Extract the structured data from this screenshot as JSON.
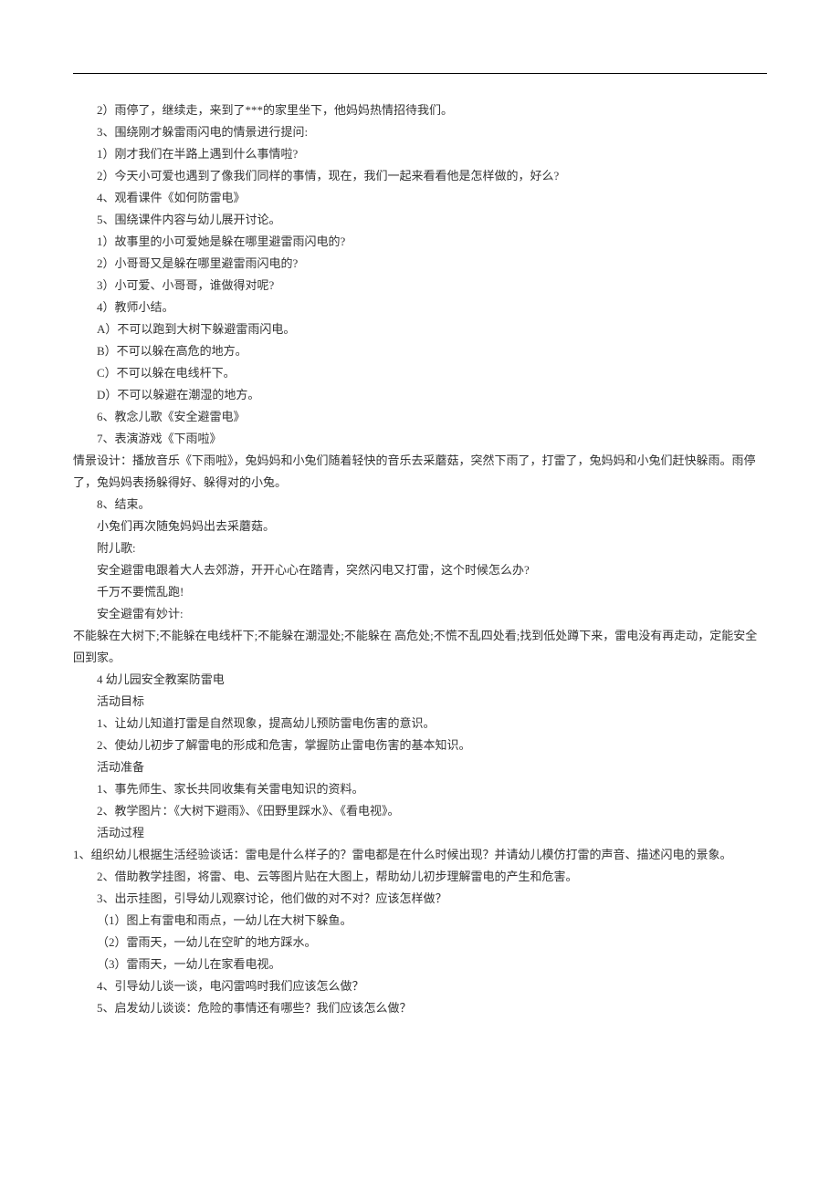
{
  "lines": [
    "2）雨停了，继续走，来到了***的家里坐下，他妈妈热情招待我们。",
    "3、围绕刚才躲雷雨闪电的情景进行提问:",
    "1）刚才我们在半路上遇到什么事情啦?",
    "2）今天小可爱也遇到了像我们同样的事情，现在，我们一起来看看他是怎样做的，好么?",
    "4、观看课件《如何防雷电》",
    "5、围绕课件内容与幼儿展开讨论。",
    "1）故事里的小可爱她是躲在哪里避雷雨闪电的?",
    "2）小哥哥又是躲在哪里避雷雨闪电的?",
    "3）小可爱、小哥哥，谁做得对呢?",
    "4）教师小结。",
    "A）不可以跑到大树下躲避雷雨闪电。",
    "B）不可以躲在高危的地方。",
    "C）不可以躲在电线杆下。",
    "D）不可以躲避在潮湿的地方。",
    "6、教念儿歌《安全避雷电》",
    "7、表演游戏《下雨啦》",
    "情景设计：播放音乐《下雨啦》，兔妈妈和小兔们随着轻快的音乐去采蘑菇，突然下雨了，打雷了，兔妈妈和小兔们赶快躲雨。雨停了，兔妈妈表扬躲得好、躲得对的小兔。",
    "8、结束。",
    "小兔们再次随兔妈妈出去采蘑菇。",
    "附儿歌:",
    "安全避雷电跟着大人去郊游，开开心心在踏青，突然闪电又打雷，这个时候怎么办?",
    "千万不要慌乱跑!",
    "安全避雷有妙计:",
    "不能躲在大树下;不能躲在电线杆下;不能躲在潮湿处;不能躲在 高危处;不慌不乱四处看;找到低处蹲下来，雷电没有再走动，定能安全回到家。",
    "4 幼儿园安全教案防雷电",
    "活动目标",
    "1、让幼儿知道打雷是自然现象，提高幼儿预防雷电伤害的意识。",
    "2、使幼儿初步了解雷电的形成和危害，掌握防止雷电伤害的基本知识。",
    "活动准备",
    "1、事先师生、家长共同收集有关雷电知识的资料。",
    "2、教学图片：《大树下避雨》、《田野里踩水》、《看电视》。",
    "活动过程",
    "1、组织幼儿根据生活经验谈话：雷电是什么样子的？雷电都是在什么时候出现？并请幼儿模仿打雷的声音、描述闪电的景象。",
    "2、借助教学挂图，将雷、电、云等图片贴在大图上，帮助幼儿初步理解雷电的产生和危害。",
    "3、出示挂图，引导幼儿观察讨论，他们做的对不对？应该怎样做？",
    "（1）图上有雷电和雨点，一幼儿在大树下躲鱼。",
    "（2）雷雨天，一幼儿在空旷的地方踩水。",
    "（3）雷雨天，一幼儿在家看电视。",
    "4、引导幼儿谈一谈，电闪雷鸣时我们应该怎么做？",
    "5、启发幼儿谈谈：危险的事情还有哪些？我们应该怎么做？"
  ],
  "noindent_indices": [
    16,
    23,
    32
  ]
}
